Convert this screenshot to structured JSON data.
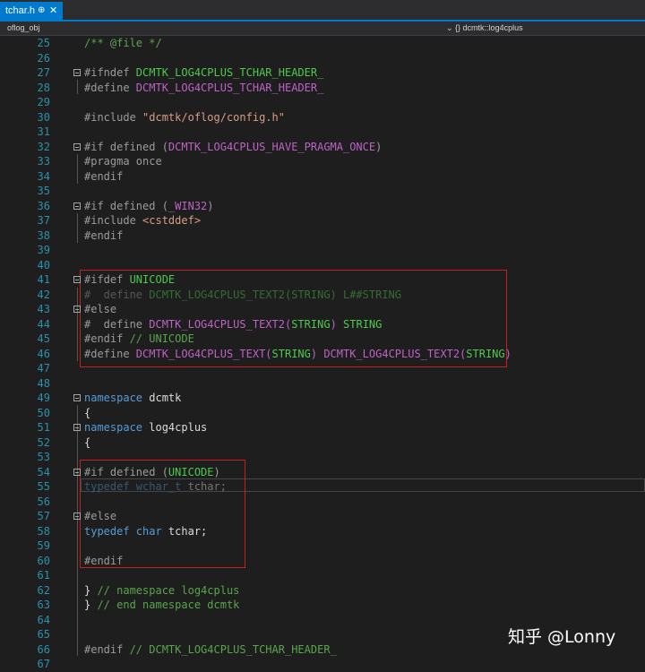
{
  "tab": {
    "title": "tchar.h",
    "pin": "⊕",
    "close": "✕"
  },
  "nav": {
    "project": "oflog_obj",
    "scope": "⌄ {} dcmtk::log4cplus"
  },
  "lines": [
    {
      "n": "25",
      "parts": [
        {
          "t": "/** @file */",
          "c": "c-comment"
        }
      ]
    },
    {
      "n": "26",
      "parts": []
    },
    {
      "n": "27",
      "fold": true,
      "parts": [
        {
          "t": "#ifndef ",
          "c": "c-pp"
        },
        {
          "t": "DCMTK_LOG4CPLUS_TCHAR_HEADER_",
          "c": "c-green"
        }
      ]
    },
    {
      "n": "28",
      "parts": [
        {
          "t": "#define ",
          "c": "c-pp"
        },
        {
          "t": "DCMTK_LOG4CPLUS_TCHAR_HEADER_",
          "c": "c-macro"
        }
      ]
    },
    {
      "n": "29",
      "parts": []
    },
    {
      "n": "30",
      "parts": [
        {
          "t": "#include ",
          "c": "c-pp"
        },
        {
          "t": "\"dcmtk/oflog/config.h\"",
          "c": "c-str"
        }
      ]
    },
    {
      "n": "31",
      "parts": []
    },
    {
      "n": "32",
      "fold": true,
      "parts": [
        {
          "t": "#if defined (",
          "c": "c-pp"
        },
        {
          "t": "DCMTK_LOG4CPLUS_HAVE_PRAGMA_ONCE",
          "c": "c-macro"
        },
        {
          "t": ")",
          "c": "c-pp"
        }
      ]
    },
    {
      "n": "33",
      "parts": [
        {
          "t": "#pragma once",
          "c": "c-pp"
        }
      ]
    },
    {
      "n": "34",
      "parts": [
        {
          "t": "#endif",
          "c": "c-pp"
        }
      ]
    },
    {
      "n": "35",
      "parts": []
    },
    {
      "n": "36",
      "fold": true,
      "parts": [
        {
          "t": "#if defined (",
          "c": "c-pp"
        },
        {
          "t": "_WIN32",
          "c": "c-macro"
        },
        {
          "t": ")",
          "c": "c-pp"
        }
      ]
    },
    {
      "n": "37",
      "parts": [
        {
          "t": "#include ",
          "c": "c-pp"
        },
        {
          "t": "<cstddef>",
          "c": "c-str"
        }
      ]
    },
    {
      "n": "38",
      "parts": [
        {
          "t": "#endif",
          "c": "c-pp"
        }
      ]
    },
    {
      "n": "39",
      "parts": []
    },
    {
      "n": "40",
      "parts": []
    },
    {
      "n": "41",
      "fold": true,
      "parts": [
        {
          "t": "#ifdef ",
          "c": "c-pp"
        },
        {
          "t": "UNICODE",
          "c": "c-green"
        }
      ]
    },
    {
      "n": "42",
      "parts": [
        {
          "t": "#  define ",
          "c": "c-pp dim"
        },
        {
          "t": "DCMTK_LOG4CPLUS_TEXT2(STRING) L##STRING",
          "c": "c-green dim"
        }
      ]
    },
    {
      "n": "43",
      "fold": true,
      "parts": [
        {
          "t": "#else",
          "c": "c-pp"
        }
      ]
    },
    {
      "n": "44",
      "parts": [
        {
          "t": "#  define ",
          "c": "c-pp"
        },
        {
          "t": "DCMTK_LOG4CPLUS_TEXT2(",
          "c": "c-macro"
        },
        {
          "t": "STRING",
          "c": "c-green"
        },
        {
          "t": ") ",
          "c": "c-macro"
        },
        {
          "t": "STRING",
          "c": "c-green"
        }
      ]
    },
    {
      "n": "45",
      "parts": [
        {
          "t": "#endif ",
          "c": "c-pp"
        },
        {
          "t": "// UNICODE",
          "c": "c-comment"
        }
      ]
    },
    {
      "n": "46",
      "parts": [
        {
          "t": "#define ",
          "c": "c-pp"
        },
        {
          "t": "DCMTK_LOG4CPLUS_TEXT(",
          "c": "c-macro"
        },
        {
          "t": "STRING",
          "c": "c-green"
        },
        {
          "t": ") DCMTK_LOG4CPLUS_TEXT2(",
          "c": "c-macro"
        },
        {
          "t": "STRING",
          "c": "c-green"
        },
        {
          "t": ")",
          "c": "c-macro"
        }
      ]
    },
    {
      "n": "47",
      "parts": []
    },
    {
      "n": "48",
      "parts": []
    },
    {
      "n": "49",
      "fold": true,
      "parts": [
        {
          "t": "namespace ",
          "c": "c-kw"
        },
        {
          "t": "dcmtk",
          "c": "c-id"
        }
      ]
    },
    {
      "n": "50",
      "parts": [
        {
          "t": "{",
          "c": "c-id"
        }
      ]
    },
    {
      "n": "51",
      "fold": true,
      "parts": [
        {
          "t": "namespace ",
          "c": "c-kw"
        },
        {
          "t": "log4cplus",
          "c": "c-id"
        }
      ]
    },
    {
      "n": "52",
      "parts": [
        {
          "t": "{",
          "c": "c-id"
        }
      ]
    },
    {
      "n": "53",
      "parts": []
    },
    {
      "n": "54",
      "fold": true,
      "parts": [
        {
          "t": "#if defined (",
          "c": "c-pp"
        },
        {
          "t": "UNICODE",
          "c": "c-green"
        },
        {
          "t": ")",
          "c": "c-pp"
        }
      ]
    },
    {
      "n": "55",
      "parts": [
        {
          "t": "typedef wchar_t ",
          "c": "c-kw dim"
        },
        {
          "t": "tchar;",
          "c": "c-id dim"
        }
      ]
    },
    {
      "n": "56",
      "parts": []
    },
    {
      "n": "57",
      "fold": true,
      "parts": [
        {
          "t": "#else",
          "c": "c-pp"
        }
      ]
    },
    {
      "n": "58",
      "parts": [
        {
          "t": "typedef char ",
          "c": "c-kw"
        },
        {
          "t": "tchar;",
          "c": "c-id"
        }
      ]
    },
    {
      "n": "59",
      "parts": []
    },
    {
      "n": "60",
      "parts": [
        {
          "t": "#endif",
          "c": "c-pp"
        }
      ]
    },
    {
      "n": "61",
      "parts": []
    },
    {
      "n": "62",
      "parts": [
        {
          "t": "} ",
          "c": "c-id"
        },
        {
          "t": "// namespace log4cplus",
          "c": "c-comment"
        }
      ]
    },
    {
      "n": "63",
      "parts": [
        {
          "t": "} ",
          "c": "c-id"
        },
        {
          "t": "// end namespace dcmtk",
          "c": "c-comment"
        }
      ]
    },
    {
      "n": "64",
      "parts": []
    },
    {
      "n": "65",
      "parts": []
    },
    {
      "n": "66",
      "parts": [
        {
          "t": "#endif ",
          "c": "c-pp"
        },
        {
          "t": "// DCMTK_LOG4CPLUS_TCHAR_HEADER_",
          "c": "c-comment"
        }
      ]
    },
    {
      "n": "67",
      "parts": []
    }
  ],
  "watermark": "知乎 @Lonny"
}
